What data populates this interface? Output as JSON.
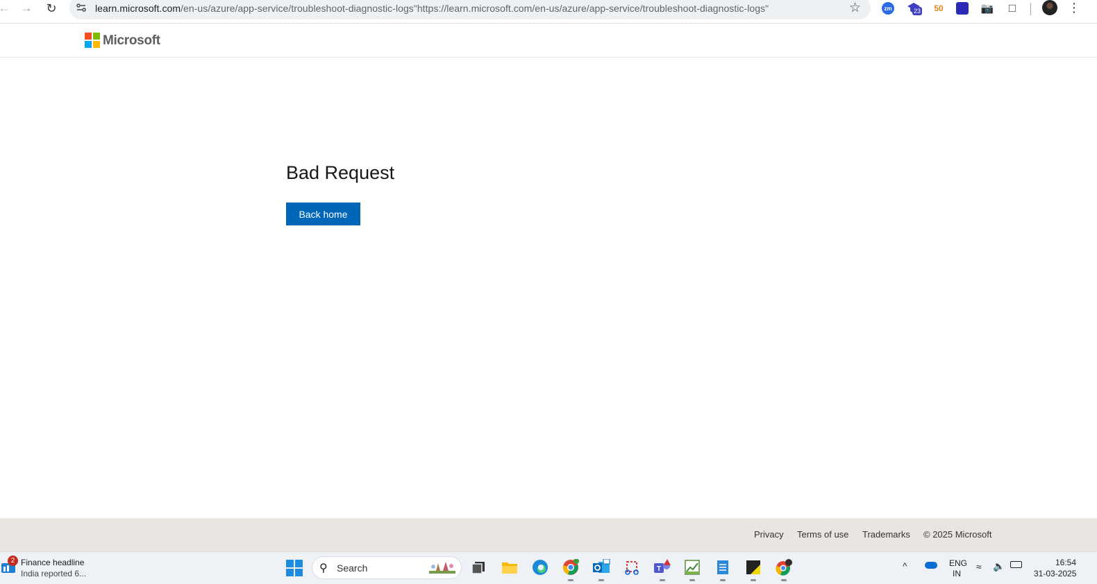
{
  "browser": {
    "url_domain": "learn.microsoft.com",
    "url_rest": "/en-us/azure/app-service/troubleshoot-diagnostic-logs\"https://learn.microsoft.com/en-us/azure/app-service/troubleshoot-diagnostic-logs\"",
    "extensions": {
      "zoom_label": "zm",
      "cap_badge": "23",
      "fifty_label": "50"
    }
  },
  "header": {
    "logo_text": "Microsoft"
  },
  "main": {
    "title": "Bad Request",
    "back_home_label": "Back home"
  },
  "footer": {
    "links": [
      "Privacy",
      "Terms of use",
      "Trademarks"
    ],
    "copyright": "© 2025 Microsoft"
  },
  "taskbar": {
    "news_badge": "2",
    "news_title": "Finance headline",
    "news_sub": "India reported 6...",
    "search_placeholder": "Search",
    "lang_top": "ENG",
    "lang_bottom": "IN",
    "time": "16:54",
    "date": "31-03-2025",
    "apps": [
      "task-view",
      "file-explorer",
      "edge",
      "chrome",
      "outlook",
      "snipping-tool",
      "teams",
      "sheet-app",
      "notepad",
      "sticky-notes",
      "chrome-profile"
    ]
  },
  "colors": {
    "accent": "#0067b8",
    "footer_bg": "#e9e6e1",
    "taskbar_bg": "#eef1f6"
  }
}
